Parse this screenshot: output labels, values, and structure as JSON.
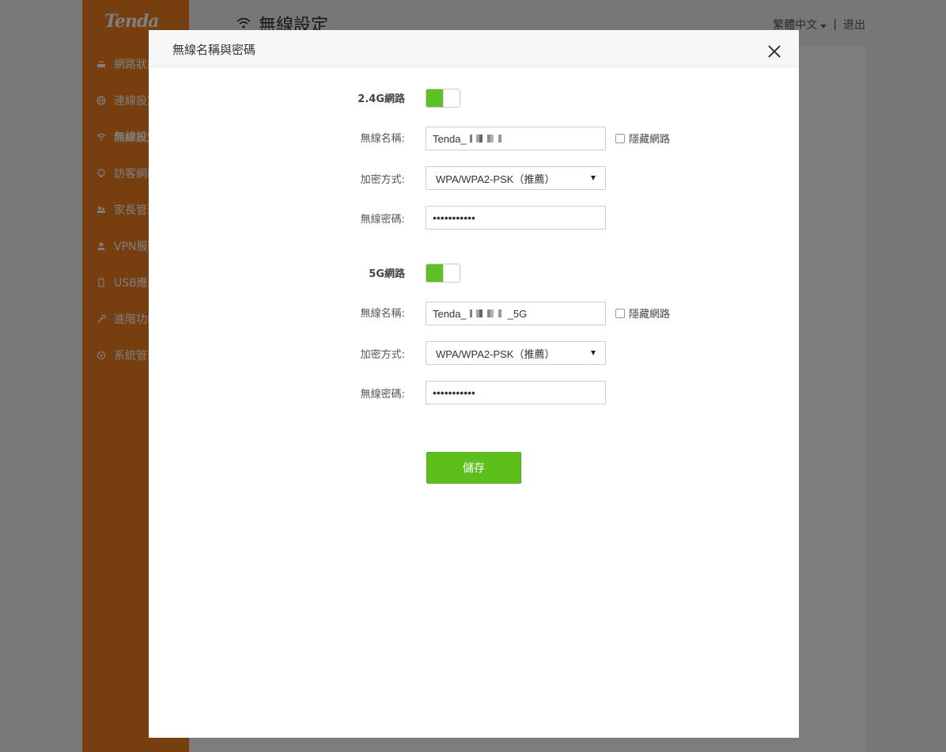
{
  "app": {
    "logo": "Tenda",
    "page_title": "無線設定",
    "language": "繁體中文",
    "separator": "|",
    "logout": "退出",
    "sidebar": {
      "items": [
        {
          "label": "網路狀態",
          "icon": "router-icon"
        },
        {
          "label": "連線設定",
          "icon": "globe-icon"
        },
        {
          "label": "無線設定",
          "icon": "wifi-icon",
          "active": true
        },
        {
          "label": "訪客網路",
          "icon": "bulb-icon"
        },
        {
          "label": "家長管理",
          "icon": "family-icon"
        },
        {
          "label": "VPN服務",
          "icon": "vpn-icon"
        },
        {
          "label": "USB應用",
          "icon": "usb-icon"
        },
        {
          "label": "進階功能",
          "icon": "wrench-icon"
        },
        {
          "label": "系統管理",
          "icon": "gear-icon"
        }
      ]
    }
  },
  "modal": {
    "title": "無線名稱與密碼",
    "band24": {
      "label": "2.4G網路",
      "enabled": true,
      "ssid_label": "無線名稱:",
      "ssid_value": "Tenda_",
      "hide_label": "隱藏網路",
      "enc_label": "加密方式:",
      "enc_value": "WPA/WPA2-PSK（推薦）",
      "pw_label": "無線密碼:",
      "pw_value": "•••••••••••"
    },
    "band5": {
      "label": "5G網路",
      "enabled": true,
      "ssid_label": "無線名稱:",
      "ssid_value": "Tenda_",
      "ssid_suffix": "_5G",
      "hide_label": "隱藏網路",
      "enc_label": "加密方式:",
      "enc_value": "WPA/WPA2-PSK（推薦）",
      "pw_label": "無線密碼:",
      "pw_value": "•••••••••••"
    },
    "save_label": "儲存"
  },
  "colors": {
    "sidebar": "#ee7d1e",
    "accent_green": "#5cbf1b"
  }
}
